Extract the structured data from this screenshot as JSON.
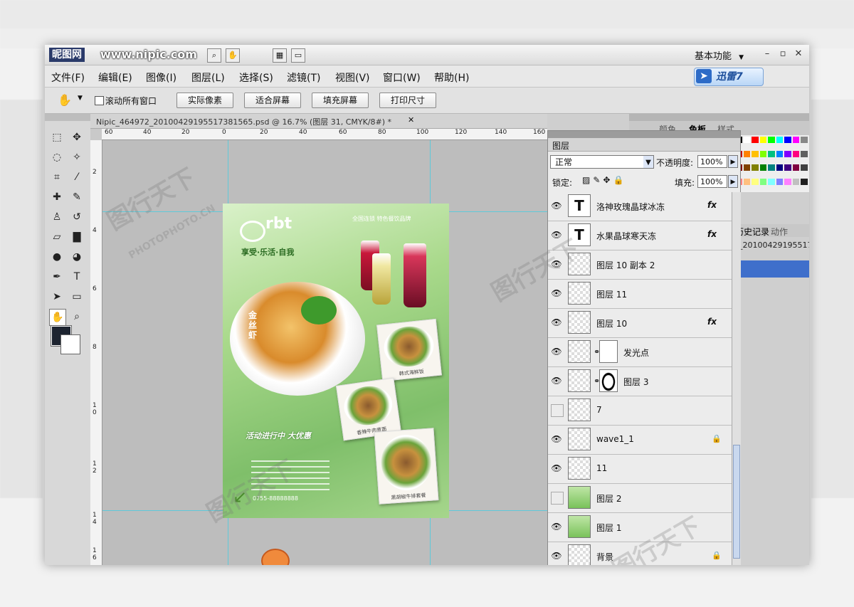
{
  "window": {
    "site_logo": "昵图网",
    "site_url": "www.nipic.com",
    "workspace": "基本功能",
    "workspace_arrow": "▼",
    "controls": {
      "minimize": "–",
      "restore": "▫",
      "close": "✕"
    }
  },
  "menu": [
    "文件(F)",
    "编辑(E)",
    "图像(I)",
    "图层(L)",
    "选择(S)",
    "滤镜(T)",
    "视图(V)",
    "窗口(W)",
    "帮助(H)"
  ],
  "xunlei": "迅雷7",
  "options": {
    "scroll_all": "滚动所有窗口",
    "buttons": [
      "实际像素",
      "适合屏幕",
      "填充屏幕",
      "打印尺寸"
    ]
  },
  "document": {
    "tab_label": "Nipic_464972_20100429195517381565.psd @ 16.7% (图层 31, CMYK/8#) *",
    "close": "✕",
    "ruler_h": [
      "60",
      "40",
      "20",
      "0",
      "20",
      "40",
      "60",
      "80",
      "100",
      "120",
      "140",
      "160"
    ],
    "ruler_v": [
      "2",
      "4",
      "6",
      "8",
      "1 0",
      "1 2",
      "1 4",
      "1 6"
    ]
  },
  "poster": {
    "brand": "rbt",
    "slogan": "享受·乐活·自我",
    "tagline": "全国连锁 特色餐饮品牌",
    "dish_label": "金丝虾",
    "photo_caption_1": "韩式海鲜饭",
    "photo_caption_2": "香辣牛肉意面",
    "photo_caption_3": "黑胡椒牛排套餐",
    "promo": "活动进行中 大优惠",
    "phone": "0755-88888888"
  },
  "panels": {
    "top_tabs": [
      "颜色",
      "色板",
      "样式"
    ],
    "history_tabs": [
      "历史记录",
      "动作"
    ],
    "history_item": "2_20100429195517381...",
    "swatches": [
      "#000000",
      "#ffffff",
      "#ff0000",
      "#ffff00",
      "#00ff00",
      "#00ffff",
      "#0000ff",
      "#ff00ff",
      "#888888",
      "#c00000",
      "#ff8000",
      "#ffc000",
      "#80ff00",
      "#00c080",
      "#0080ff",
      "#8000ff",
      "#ff0080",
      "#606060",
      "#800000",
      "#804000",
      "#808000",
      "#008000",
      "#008080",
      "#000080",
      "#400080",
      "#800040",
      "#404040",
      "#ff8080",
      "#ffc080",
      "#ffff80",
      "#80ff80",
      "#80ffff",
      "#8080ff",
      "#ff80ff",
      "#c0c0c0",
      "#202020"
    ]
  },
  "layers": {
    "title": "图层",
    "blend_mode": "正常",
    "opacity_label": "不透明度:",
    "opacity_value": "100%",
    "lock_label": "锁定:",
    "fill_label": "填充:",
    "fill_value": "100%",
    "items": [
      {
        "name": "洛神玫瑰晶球冰冻",
        "type": "text",
        "visible": true,
        "fx": "fx"
      },
      {
        "name": "水果晶球寒天冻",
        "type": "text",
        "visible": true,
        "fx": "fx"
      },
      {
        "name": "图层 10 副本 2",
        "type": "pixel",
        "visible": true
      },
      {
        "name": "图层 11",
        "type": "pixel",
        "visible": true
      },
      {
        "name": "图层 10",
        "type": "pixel",
        "visible": true,
        "fx": "fx"
      },
      {
        "name": "发光点",
        "type": "masked",
        "visible": true
      },
      {
        "name": "图层 3",
        "type": "masked-shape",
        "visible": true
      },
      {
        "name": "7",
        "type": "pixel",
        "visible": false
      },
      {
        "name": "wave1_1",
        "type": "pixel",
        "visible": true,
        "locked": true
      },
      {
        "name": "11",
        "type": "pixel",
        "visible": true
      },
      {
        "name": "图层 2",
        "type": "green",
        "visible": false
      },
      {
        "name": "图层 1",
        "type": "green",
        "visible": true
      },
      {
        "name": "背景",
        "type": "pixel",
        "visible": true,
        "locked": true
      }
    ]
  },
  "watermark": {
    "cn": "图行天下",
    "en": "PHOTOPHOTO.CN"
  }
}
